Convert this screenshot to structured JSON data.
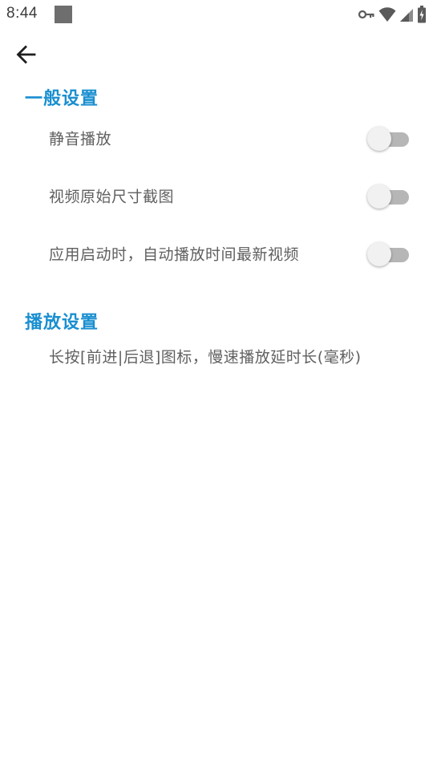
{
  "status_bar": {
    "time": "8:44"
  },
  "toolbar": {
    "back_icon": "arrow-back-icon"
  },
  "sections": {
    "general": {
      "title": "一般设置",
      "items": [
        {
          "label": "静音播放",
          "enabled": false
        },
        {
          "label": "视频原始尺寸截图",
          "enabled": false
        },
        {
          "label": "应用启动时，自动播放时间最新视频",
          "enabled": false
        }
      ]
    },
    "playback": {
      "title": "播放设置",
      "items": [
        {
          "label": "长按[前进|后退]图标，慢速播放延时长(毫秒)"
        }
      ]
    }
  },
  "colors": {
    "accent": "#1a8fd0",
    "text": "#5f5f5f",
    "switch_track_off": "#b6b6b6",
    "switch_thumb_off": "#f1f1f1"
  }
}
